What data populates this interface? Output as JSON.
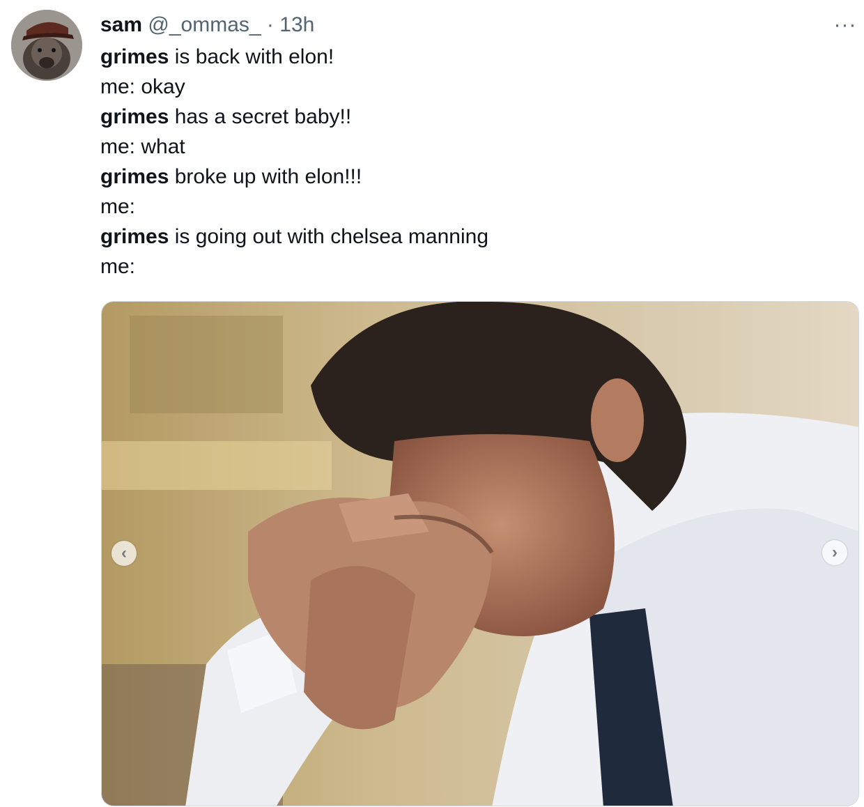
{
  "tweet": {
    "author": {
      "name": "sam",
      "handle": "@_ommas_",
      "separator": "·",
      "time": "13h",
      "avatar_icon": "marten-with-cap-avatar"
    },
    "more_icon": "more-horizontal-icon",
    "more_label": "···",
    "lines": [
      {
        "bold": "grimes",
        "rest": " is back with elon!"
      },
      {
        "bold": "",
        "rest": "me: okay"
      },
      {
        "bold": "grimes",
        "rest": " has a secret baby!!"
      },
      {
        "bold": "",
        "rest": "me: what"
      },
      {
        "bold": "grimes",
        "rest": " broke up with elon!!!"
      },
      {
        "bold": "",
        "rest": "me:"
      },
      {
        "bold": "grimes",
        "rest": " is going out with chelsea manning"
      },
      {
        "bold": "",
        "rest": "me:"
      }
    ],
    "media": {
      "kind": "photo",
      "prev_icon": "chevron-left-icon",
      "next_icon": "chevron-right-icon",
      "prev_label": "‹",
      "next_label": "›"
    }
  },
  "colors": {
    "text": "#0f1419",
    "secondary": "#536471",
    "border": "#cfd9de"
  }
}
